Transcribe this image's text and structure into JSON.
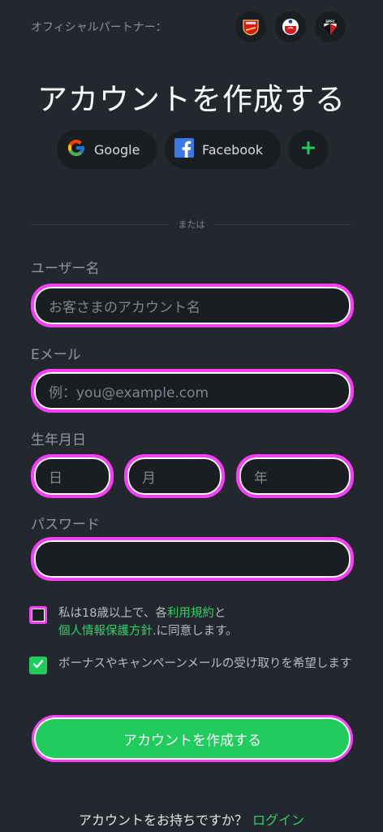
{
  "partners": {
    "label": "オフィシャルパートナー：",
    "badges": [
      {
        "icon": "arsenal-crest-icon",
        "text": "Arsenal",
        "color": "#d7191f"
      },
      {
        "icon": "southampton-crest-icon",
        "text": "",
        "color": "#d71920"
      },
      {
        "icon": "sao-paulo-crest-icon",
        "text": "SPFC",
        "color": "#d71920"
      }
    ]
  },
  "title": "アカウントを作成する",
  "social": {
    "google_label": "Google",
    "facebook_label": "Facebook",
    "more_icon": "plus-icon"
  },
  "divider_text": "または",
  "form": {
    "username": {
      "label": "ユーザー名",
      "placeholder": "お客さまのアカウント名",
      "value": ""
    },
    "email": {
      "label": "Eメール",
      "placeholder": "例：you@example.com",
      "value": ""
    },
    "dob": {
      "label": "生年月日",
      "day_placeholder": "日",
      "month_placeholder": "月",
      "year_placeholder": "年"
    },
    "password": {
      "label": "パスワード",
      "value": ""
    }
  },
  "terms": {
    "checked": false,
    "text_before": "私は18歳以上で、各",
    "terms_link": "利用規約",
    "text_mid": "と",
    "privacy_link": "個人情報保護方針",
    "text_after": ".に同意します。"
  },
  "marketing": {
    "checked": true,
    "text": "ボーナスやキャンペーンメールの受け取りを希望します"
  },
  "submit_label": "アカウントを作成する",
  "footer": {
    "text": "アカウントをお持ちですか？",
    "login_link": "ログイン"
  },
  "colors": {
    "background": "#23282e",
    "accent_green": "#1fcc5c",
    "highlight": "#ff3bff"
  }
}
